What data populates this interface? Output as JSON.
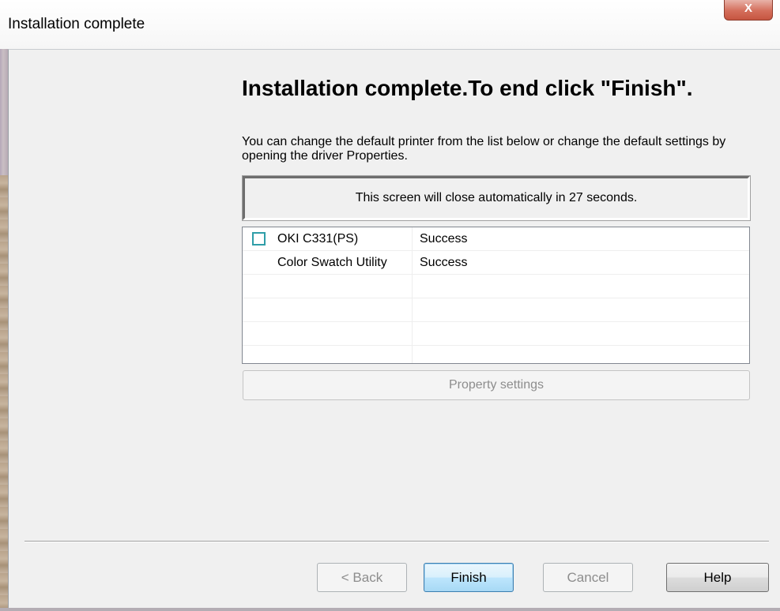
{
  "window": {
    "title": "Installation complete",
    "close_glyph": "X"
  },
  "main": {
    "heading": "Installation complete.To end click \"Finish\".",
    "description": "You can change the default printer from the list below or change the default settings by opening the driver Properties.",
    "countdown": "This screen will close automatically in 27 seconds."
  },
  "list": {
    "rows": [
      {
        "name": "OKI C331(PS)",
        "status": "Success",
        "has_checkbox": true,
        "checked": false
      },
      {
        "name": "Color Swatch Utility",
        "status": "Success",
        "has_checkbox": false
      },
      {
        "name": "",
        "status": ""
      },
      {
        "name": "",
        "status": ""
      },
      {
        "name": "",
        "status": ""
      }
    ]
  },
  "property_button": {
    "label": "Property settings",
    "enabled": false
  },
  "footer": {
    "back_label": "< Back",
    "finish_label": "Finish",
    "cancel_label": "Cancel",
    "help_label": "Help"
  },
  "colors": {
    "checkbox_border": "#2f9ea8",
    "default_button_border": "#3c7fb1",
    "close_button": "#c65540"
  },
  "icons": {
    "close": "close-icon"
  }
}
